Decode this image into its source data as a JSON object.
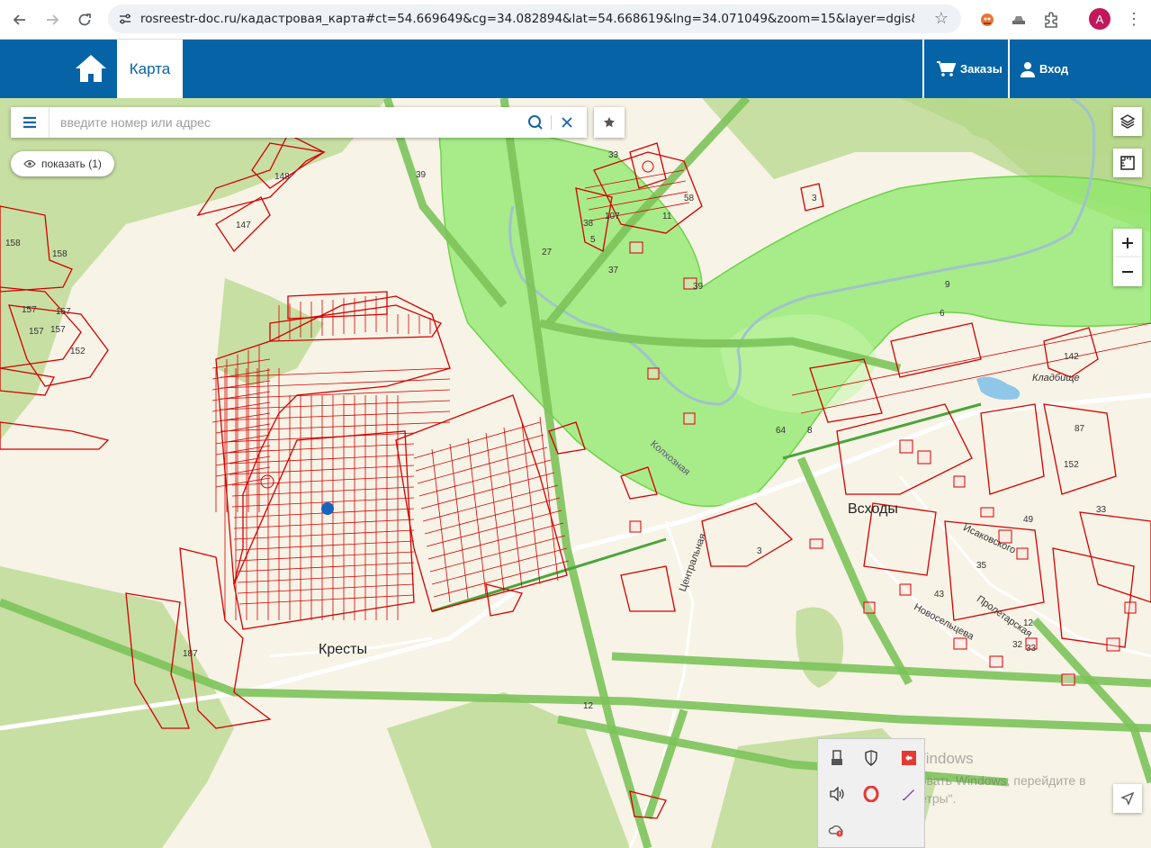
{
  "browser": {
    "url": "rosreestr-doc.ru/кадастровая_карта#ct=54.669649&cg=34.082894&lat=54.668619&lng=34.071049&zoom=15&layer=dgis&zouit=true",
    "profile_initial": "A"
  },
  "header": {
    "tab_label": "Карта",
    "orders_label": "Заказы",
    "login_label": "Вход"
  },
  "search": {
    "placeholder": "введите номер или адрес",
    "show_label": "показать (1)"
  },
  "map": {
    "places": [
      "Всходы",
      "Кресты"
    ],
    "streets": [
      "Исаковского",
      "Новосельцева",
      "Пролетарская",
      "Центральная",
      "Колхозная"
    ],
    "landmarks": [
      "Кладбище"
    ],
    "parcel_numbers": [
      "148",
      "147",
      "158",
      "158",
      "157",
      "157",
      "157",
      "157",
      "152",
      "39",
      "33",
      "58",
      "107",
      "11",
      "38",
      "5",
      "27",
      "37",
      "39",
      "3",
      "9",
      "6",
      "142",
      "64",
      "8",
      "49",
      "152",
      "87",
      "33",
      "35",
      "43",
      "12",
      "32",
      "33",
      "187",
      "3",
      "12"
    ],
    "colors": {
      "parcel_outline": "#d40000",
      "protection_zone": "#8ee86a",
      "road_strip": "#7cc35a",
      "forest": "#c7dfa3",
      "background": "#f7f3e6",
      "marker": "#1565c0"
    }
  },
  "watermark": {
    "line1": "Активация Windows",
    "line2": "Чтобы активировать Windows, перейдите в",
    "line3": "раздел \"Параметры\"."
  }
}
